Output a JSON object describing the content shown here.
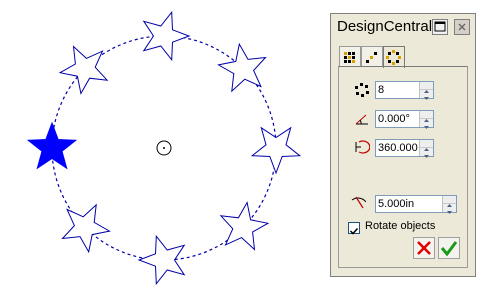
{
  "drawing": {
    "circle_color": "#0000aa",
    "selected_star_color": "#0000ff"
  },
  "panel": {
    "title": "DesignCentral",
    "tabs": [
      {
        "icon": "grid-dots-icon"
      },
      {
        "icon": "path-points-icon"
      },
      {
        "icon": "circle-dots-icon"
      }
    ],
    "active_tab": 2,
    "fields": {
      "count": {
        "value": "8",
        "icon": "count-dots-icon"
      },
      "start_angle": {
        "value": "0.000°",
        "icon": "angle-icon"
      },
      "total_angle": {
        "value": "360.000",
        "icon": "arc-angle-icon"
      },
      "radius": {
        "value": "5.000in",
        "icon": "radius-icon"
      }
    },
    "rotate_objects": {
      "label": "Rotate objects",
      "checked": true
    },
    "cancel_color": "#e00000",
    "ok_color": "#1a9a1a"
  }
}
